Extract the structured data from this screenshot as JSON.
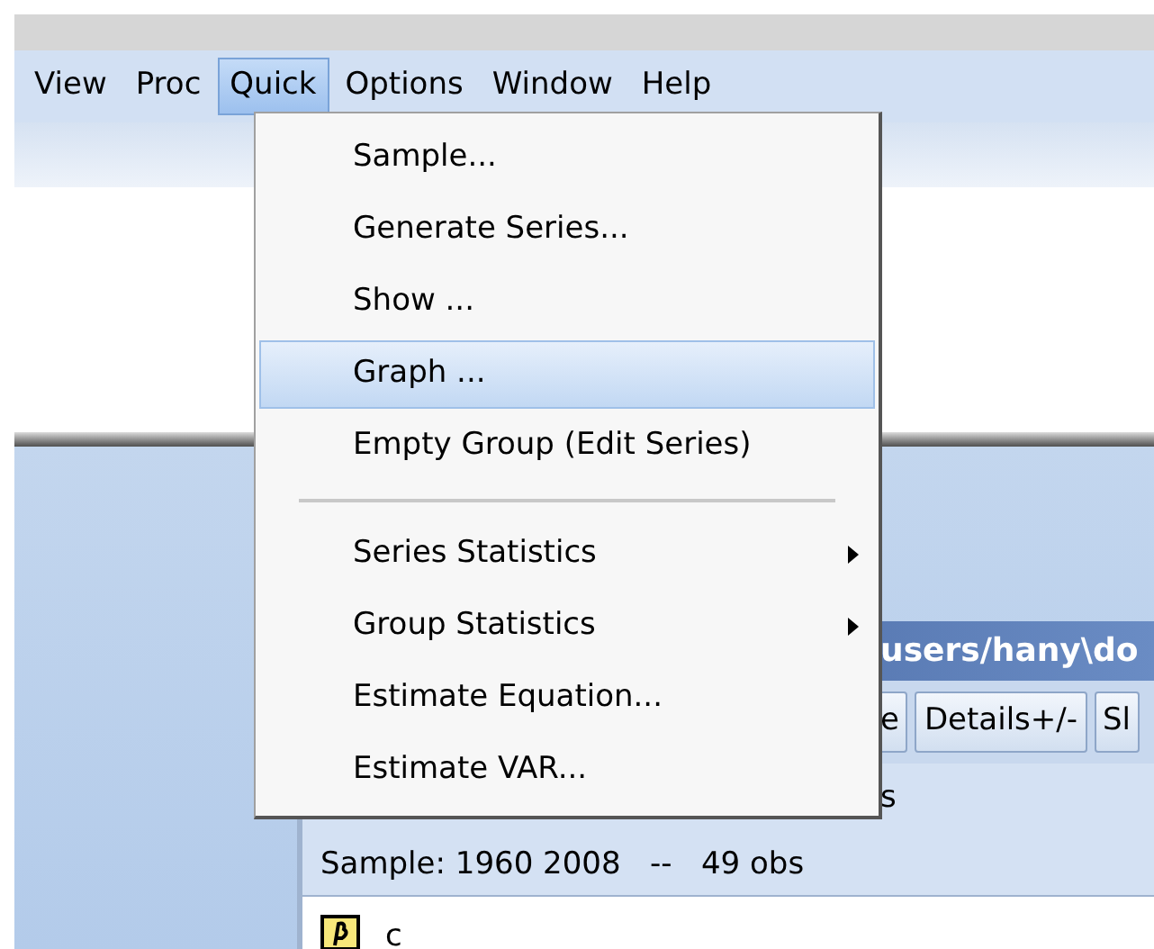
{
  "menu_bar": [
    {
      "label": "View",
      "selected": false
    },
    {
      "label": "Proc",
      "selected": false
    },
    {
      "label": "Quick",
      "selected": true
    },
    {
      "label": "Options",
      "selected": false
    },
    {
      "label": "Window",
      "selected": false
    },
    {
      "label": "Help",
      "selected": false
    }
  ],
  "dropdown": [
    {
      "kind": "item",
      "label": "Sample...",
      "selected": false,
      "submenu": false
    },
    {
      "kind": "item",
      "label": "Generate Series...",
      "selected": false,
      "submenu": false
    },
    {
      "kind": "item",
      "label": "Show ...",
      "selected": false,
      "submenu": false
    },
    {
      "kind": "item",
      "label": "Graph ...",
      "selected": true,
      "submenu": false
    },
    {
      "kind": "item",
      "label": "Empty Group (Edit Series)",
      "selected": false,
      "submenu": false
    },
    {
      "kind": "separator"
    },
    {
      "kind": "item",
      "label": "Series Statistics",
      "selected": false,
      "submenu": true
    },
    {
      "kind": "item",
      "label": "Group Statistics",
      "selected": false,
      "submenu": true
    },
    {
      "kind": "item",
      "label": "Estimate Equation...",
      "selected": false,
      "submenu": false
    },
    {
      "kind": "item",
      "label": "Estimate VAR...",
      "selected": false,
      "submenu": false
    }
  ],
  "child_window": {
    "title": "users/hany\\do",
    "toolbar": [
      "e",
      "Details+/-",
      "Sl"
    ],
    "info_line": "s",
    "sample_line": "Sample: 1960 2008   --   49 obs",
    "first_item": "c"
  }
}
